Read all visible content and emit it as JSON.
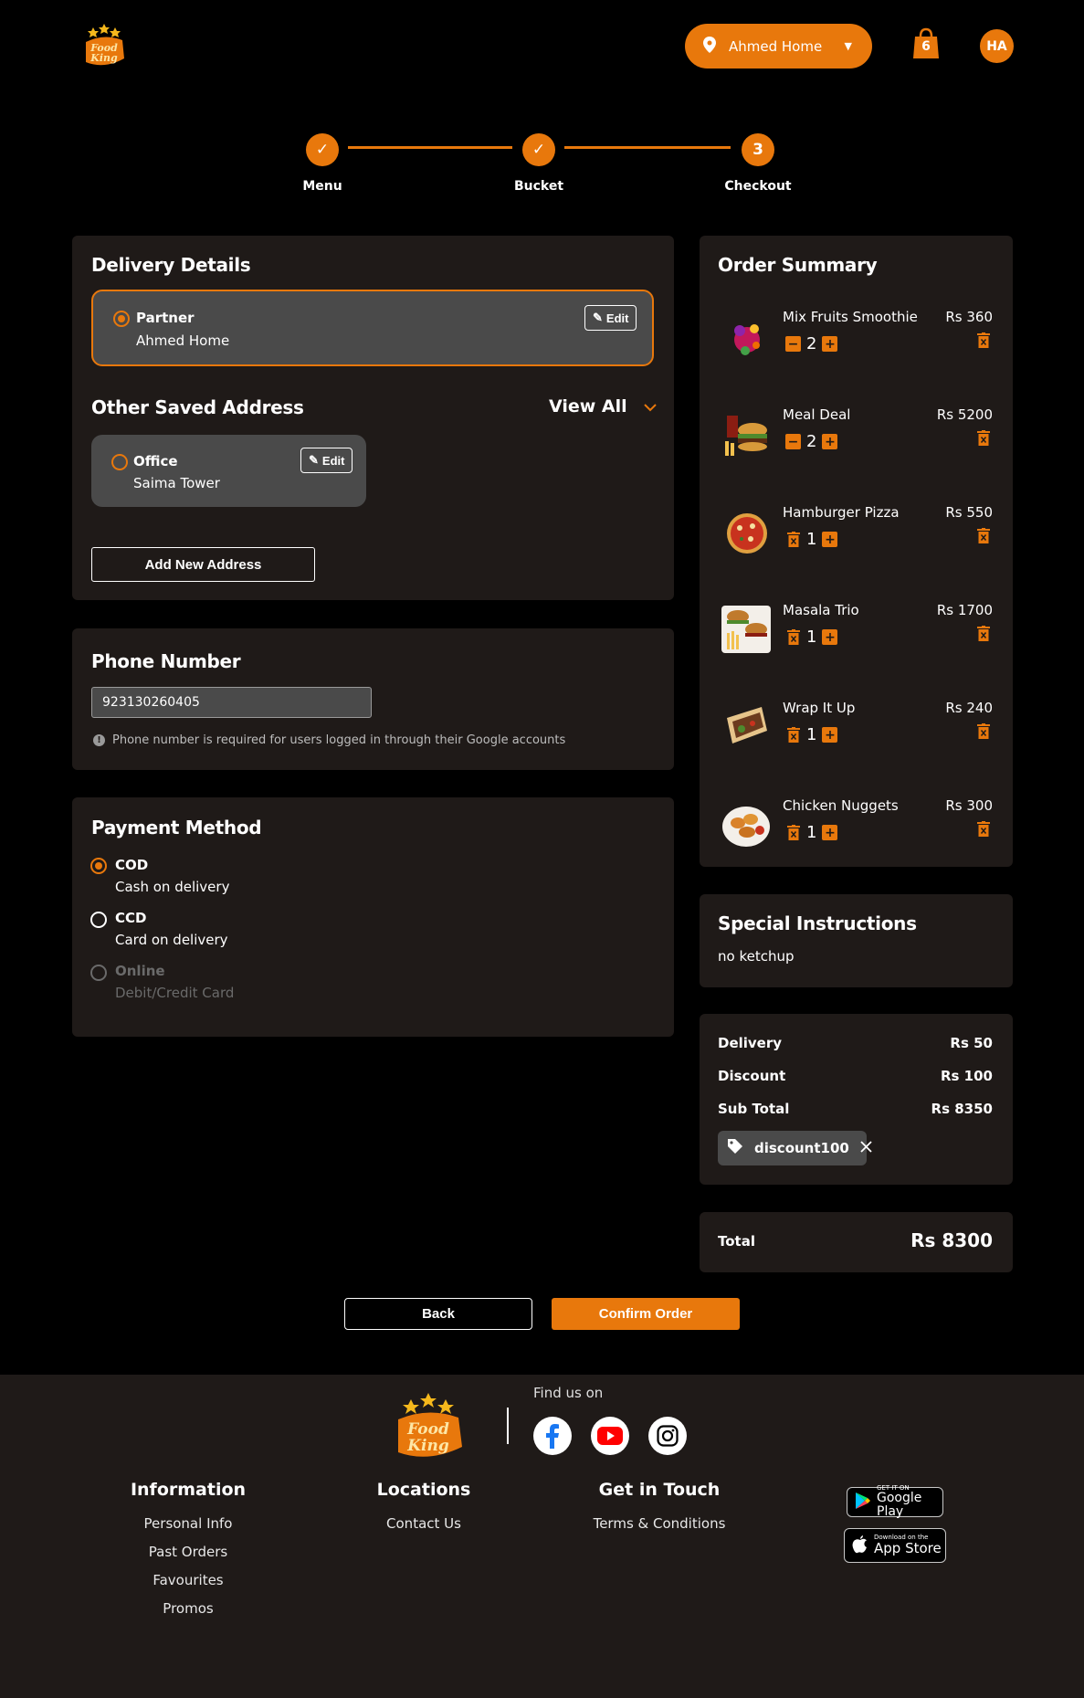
{
  "header": {
    "logo_text": "Food King",
    "location_label": "Ahmed Home",
    "cart_count": "6",
    "avatar_initials": "HA"
  },
  "stepper": {
    "steps": [
      {
        "label": "Menu",
        "state": "done"
      },
      {
        "label": "Bucket",
        "state": "done"
      },
      {
        "label": "Checkout",
        "state": "current",
        "number": "3"
      }
    ]
  },
  "delivery": {
    "title": "Delivery Details",
    "selected": {
      "type": "Partner",
      "name": "Ahmed Home",
      "edit_label": "Edit"
    },
    "other_title": "Other Saved Address",
    "view_all_label": "View All",
    "other": [
      {
        "type": "Office",
        "name": "Saima Tower",
        "edit_label": "Edit"
      }
    ],
    "add_new_label": "Add New Address"
  },
  "phone": {
    "title": "Phone Number",
    "value": "923130260405",
    "hint": "Phone number is required for users logged in through their Google accounts"
  },
  "payment": {
    "title": "Payment Method",
    "options": [
      {
        "code": "COD",
        "desc": "Cash on delivery",
        "state": "selected"
      },
      {
        "code": "CCD",
        "desc": "Card on delivery",
        "state": "available"
      },
      {
        "code": "Online",
        "desc": "Debit/Credit Card",
        "state": "disabled"
      }
    ]
  },
  "order_summary": {
    "title": "Order Summary",
    "items": [
      {
        "name": "Mix Fruits Smoothie",
        "price": "Rs 360",
        "qty": "2",
        "left_icon": "minus-icon"
      },
      {
        "name": "Meal Deal",
        "price": "Rs 5200",
        "qty": "2",
        "left_icon": "minus-icon"
      },
      {
        "name": "Hamburger Pizza",
        "price": "Rs 550",
        "qty": "1",
        "left_icon": "trash-icon"
      },
      {
        "name": "Masala Trio",
        "price": "Rs 1700",
        "qty": "1",
        "left_icon": "trash-icon"
      },
      {
        "name": "Wrap It Up",
        "price": "Rs 240",
        "qty": "1",
        "left_icon": "trash-icon"
      },
      {
        "name": "Chicken Nuggets",
        "price": "Rs 300",
        "qty": "1",
        "left_icon": "trash-icon"
      }
    ]
  },
  "special": {
    "title": "Special Instructions",
    "text": "no ketchup"
  },
  "totals": {
    "delivery_label": "Delivery",
    "delivery_value": "Rs 50",
    "discount_label": "Discount",
    "discount_value": "Rs 100",
    "subtotal_label": "Sub Total",
    "subtotal_value": "Rs 8350",
    "coupon_code": "discount100",
    "total_label": "Total",
    "total_value": "Rs 8300"
  },
  "actions": {
    "back_label": "Back",
    "confirm_label": "Confirm Order"
  },
  "footer": {
    "find_us": "Find us on",
    "columns": [
      {
        "heading": "Information",
        "links": [
          "Personal Info",
          "Past Orders",
          "Favourites",
          "Promos"
        ]
      },
      {
        "heading": "Locations",
        "links": [
          "Contact Us"
        ]
      },
      {
        "heading": "Get in Touch",
        "links": [
          "Terms & Conditions"
        ]
      }
    ],
    "google_play": {
      "small": "GET IT ON",
      "big": "Google Play"
    },
    "app_store": {
      "small": "Download on the",
      "big": "App Store"
    }
  },
  "colors": {
    "accent": "#e8780c",
    "panel": "#1f1a18",
    "background": "#000000",
    "card": "#4a4a4a"
  }
}
